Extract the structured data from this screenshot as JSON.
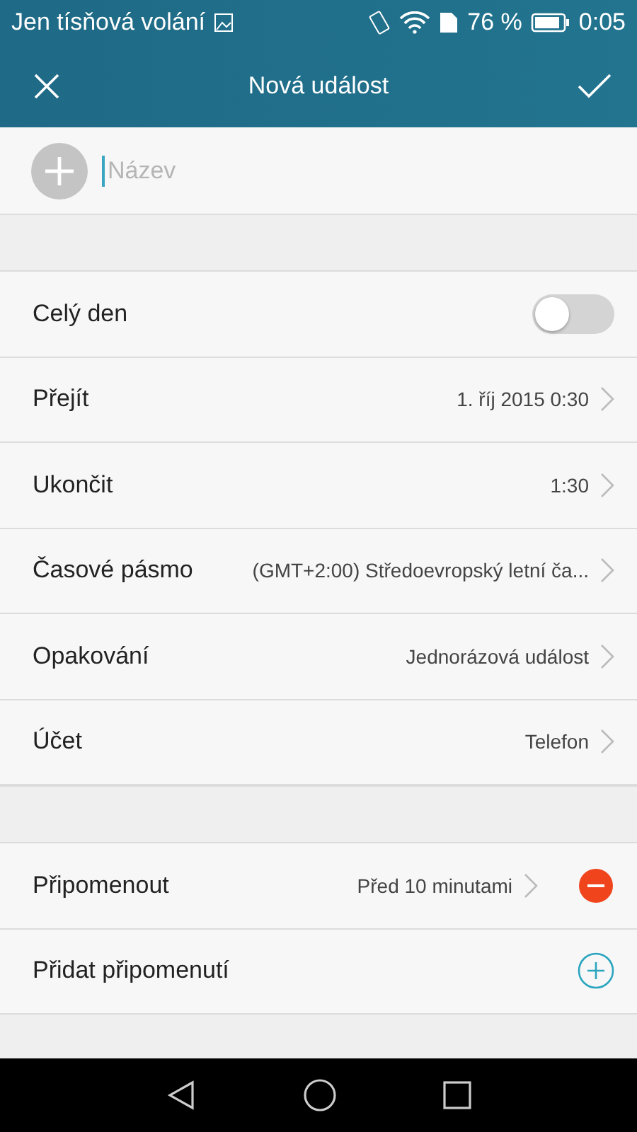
{
  "status_bar": {
    "carrier": "Jen tísňová volání",
    "battery": "76 %",
    "time": "0:05"
  },
  "app_bar": {
    "title": "Nová událost"
  },
  "title_field": {
    "placeholder": "Název"
  },
  "sections": [
    {
      "rows": [
        {
          "kind": "toggle",
          "label": "Celý den",
          "on": false
        },
        {
          "kind": "value",
          "label": "Přejít",
          "value": "1. říj 2015 0:30"
        },
        {
          "kind": "value",
          "label": "Ukončit",
          "value": "1:30"
        },
        {
          "kind": "value",
          "label": "Časové pásmo",
          "value": "(GMT+2:00) Středoevropský letní ča..."
        },
        {
          "kind": "value",
          "label": "Opakování",
          "value": "Jednorázová událost"
        },
        {
          "kind": "value",
          "label": "Účet",
          "value": "Telefon"
        }
      ]
    },
    {
      "rows": [
        {
          "kind": "reminder",
          "label": "Připomenout",
          "value": "Před 10 minutami"
        },
        {
          "kind": "add",
          "label": "Přidat připomenutí"
        }
      ]
    }
  ]
}
